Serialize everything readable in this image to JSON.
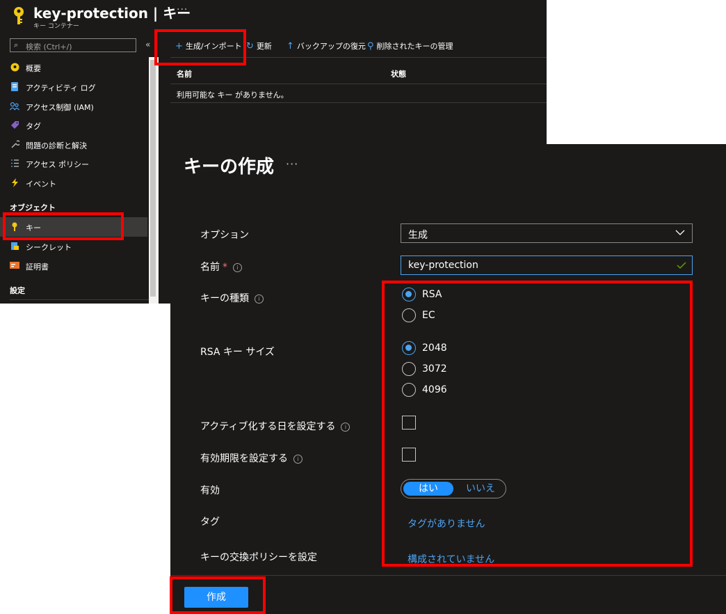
{
  "header": {
    "title": "key-protection | キー",
    "more": "···",
    "subtitle": "キー コンテナー"
  },
  "search": {
    "placeholder": "検索 (Ctrl+/)"
  },
  "sidebar": {
    "collapse": "«",
    "items": [
      {
        "label": "概要",
        "icon": "overview-icon"
      },
      {
        "label": "アクティビティ ログ",
        "icon": "activity-log-icon"
      },
      {
        "label": "アクセス制御 (IAM)",
        "icon": "iam-icon"
      },
      {
        "label": "タグ",
        "icon": "tag-icon"
      },
      {
        "label": "問題の診断と解決",
        "icon": "wrench-icon"
      },
      {
        "label": "アクセス ポリシー",
        "icon": "policy-icon"
      },
      {
        "label": "イベント",
        "icon": "lightning-icon"
      }
    ],
    "section_objects": "オブジェクト",
    "objects": [
      {
        "label": "キー",
        "icon": "key-icon",
        "selected": true
      },
      {
        "label": "シークレット",
        "icon": "secret-icon"
      },
      {
        "label": "証明書",
        "icon": "certificate-icon"
      }
    ],
    "section_settings": "設定"
  },
  "toolbar": {
    "generate_import": "生成/インポート",
    "refresh": "更新",
    "restore_backup": "バックアップの復元",
    "manage_deleted": "削除されたキーの管理"
  },
  "table": {
    "columns": [
      "名前",
      "状態"
    ],
    "empty_message": "利用可能な キー がありません。"
  },
  "dialog": {
    "title": "キーの作成",
    "more": "···",
    "options_label": "オプション",
    "options_value": "生成",
    "name_label": "名前",
    "required_mark": "*",
    "name_value": "key-protection",
    "key_type_label": "キーの種類",
    "key_types": [
      "RSA",
      "EC"
    ],
    "key_type_selected": "RSA",
    "rsa_size_label": "RSA キー サイズ",
    "rsa_sizes": [
      "2048",
      "3072",
      "4096"
    ],
    "rsa_size_selected": "2048",
    "activation_label": "アクティブ化する日を設定する",
    "expiration_label": "有効期限を設定する",
    "enabled_label": "有効",
    "enabled_yes": "はい",
    "enabled_no": "いいえ",
    "enabled_selected": "はい",
    "tags_label": "タグ",
    "tags_value": "タグがありません",
    "rotation_label": "キーの交換ポリシーを設定",
    "rotation_value": "構成されていません",
    "create_button": "作成",
    "info": "i"
  },
  "colors": {
    "accent": "#4ea3f1",
    "primary_button": "#1e90ff",
    "highlight": "#ff0000",
    "background": "#1b1a19"
  }
}
